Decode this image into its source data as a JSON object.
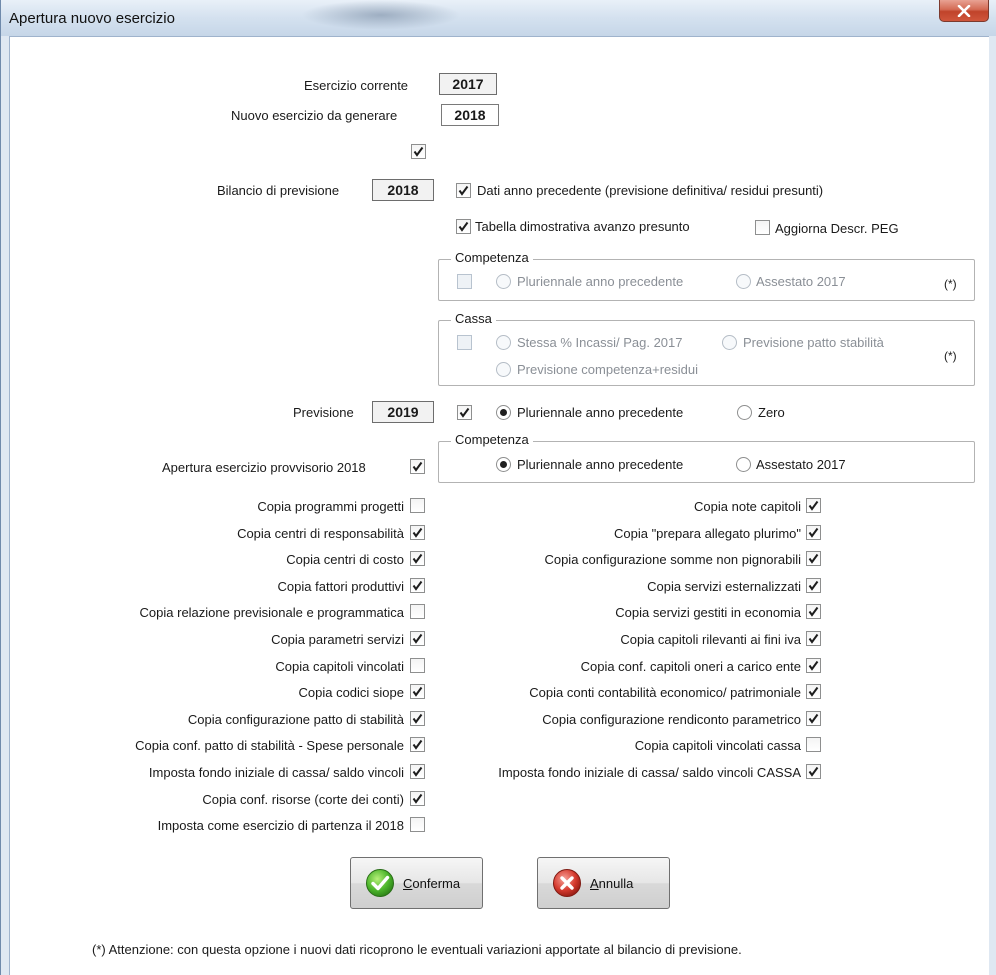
{
  "window": {
    "title": "Apertura nuovo esercizio"
  },
  "esercizio_corrente": {
    "label": "Esercizio corrente",
    "value": "2017"
  },
  "nuovo_esercizio": {
    "label": "Nuovo esercizio da generare",
    "value": "2018"
  },
  "bilancio": {
    "label": "Bilancio di previsione",
    "value": "2018",
    "dati_anno_precedente": "Dati anno precedente (previsione definitiva/ residui presunti)",
    "tabella_avanzo": "Tabella dimostrativa avanzo presunto",
    "aggiorna_peg": "Aggiorna Descr. PEG"
  },
  "competenza_1": {
    "title": "Competenza",
    "opt1": "Pluriennale anno precedente",
    "opt2": "Assestato 2017",
    "note": "(*)"
  },
  "cassa": {
    "title": "Cassa",
    "opt1": "Stessa % Incassi/ Pag. 2017",
    "opt2": "Previsione patto stabilità",
    "opt3": "Previsione competenza+residui",
    "note": "(*)"
  },
  "previsione": {
    "label": "Previsione",
    "value": "2019",
    "opt1": "Pluriennale anno precedente",
    "opt2": "Zero"
  },
  "competenza_2": {
    "title": "Competenza",
    "opt1": "Pluriennale anno precedente",
    "opt2": "Assestato 2017"
  },
  "apertura_provvisorio": {
    "label": "Apertura esercizio provvisorio 2018"
  },
  "left_options": [
    {
      "label": "Copia programmi progetti",
      "checked": false
    },
    {
      "label": "Copia centri di responsabilità",
      "checked": true
    },
    {
      "label": "Copia centri di costo",
      "checked": true
    },
    {
      "label": "Copia fattori produttivi",
      "checked": true
    },
    {
      "label": "Copia relazione previsionale e programmatica",
      "checked": false
    },
    {
      "label": "Copia parametri servizi",
      "checked": true
    },
    {
      "label": "Copia capitoli vincolati",
      "checked": false
    },
    {
      "label": "Copia codici siope",
      "checked": true
    },
    {
      "label": "Copia configurazione patto di stabilità",
      "checked": true
    },
    {
      "label": "Copia conf. patto di stabilità - Spese personale",
      "checked": true
    },
    {
      "label": "Imposta fondo iniziale di cassa/ saldo vincoli",
      "checked": true
    },
    {
      "label": "Copia conf. risorse (corte dei conti)",
      "checked": true
    },
    {
      "label": "Imposta come esercizio di partenza il 2018",
      "checked": false
    }
  ],
  "right_options": [
    {
      "label": "Copia note capitoli",
      "checked": true
    },
    {
      "label": "Copia \"prepara allegato plurimo\"",
      "checked": true
    },
    {
      "label": "Copia configurazione somme non pignorabili",
      "checked": true
    },
    {
      "label": "Copia servizi esternalizzati",
      "checked": true
    },
    {
      "label": "Copia servizi gestiti in economia",
      "checked": true
    },
    {
      "label": "Copia capitoli rilevanti ai fini iva",
      "checked": true
    },
    {
      "label": "Copia conf. capitoli oneri a carico ente",
      "checked": true
    },
    {
      "label": "Copia conti contabilità economico/ patrimoniale",
      "checked": true
    },
    {
      "label": "Copia configurazione rendiconto parametrico",
      "checked": true
    },
    {
      "label": "Copia capitoli vincolati cassa",
      "checked": false
    },
    {
      "label": "Imposta fondo iniziale di cassa/ saldo vincoli CASSA",
      "checked": true
    }
  ],
  "buttons": {
    "conferma_first": "C",
    "conferma_rest": "onferma",
    "annulla_first": "A",
    "annulla_rest": "nnulla"
  },
  "footer_note": "(*)  Attenzione: con questa opzione i nuovi dati ricoprono le eventuali variazioni apportate al bilancio di previsione."
}
